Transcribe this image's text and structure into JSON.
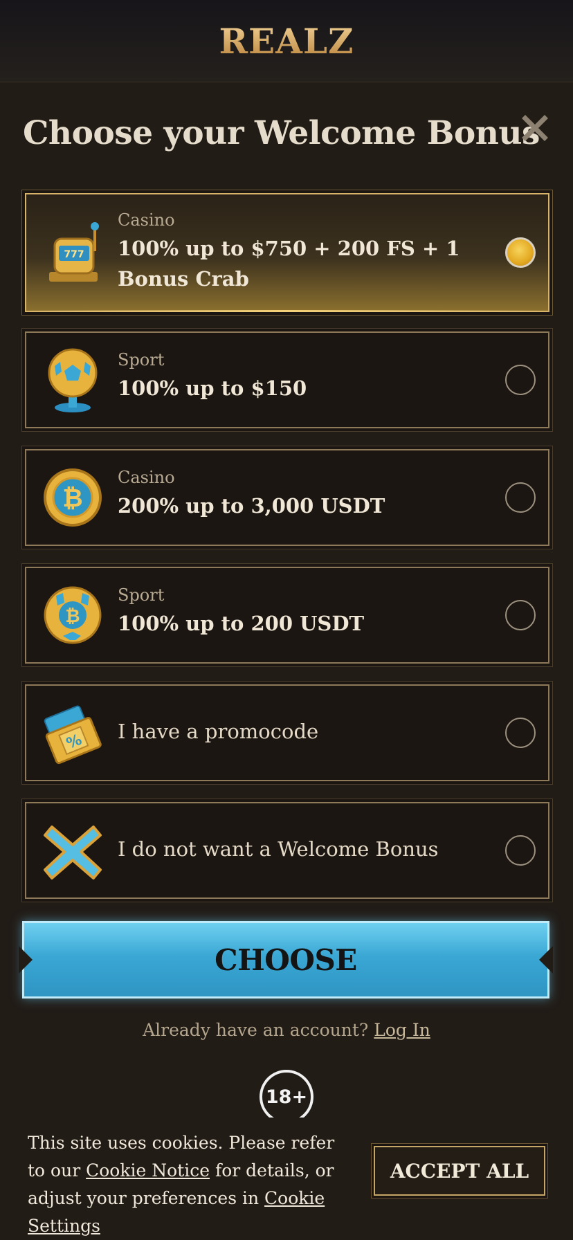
{
  "header": {
    "logo_text": "REALZ"
  },
  "modal": {
    "title": "Choose your Welcome Bonus",
    "close_icon": "close-icon",
    "options": [
      {
        "category": "Casino",
        "label": "100% up to $750 + 200 FS + 1 Bonus Crab",
        "icon": "slot-machine-icon",
        "selected": true
      },
      {
        "category": "Sport",
        "label": "100% up to $150",
        "icon": "soccer-ball-trophy-icon",
        "selected": false
      },
      {
        "category": "Casino",
        "label": "200% up to 3,000 USDT",
        "icon": "bitcoin-coin-icon",
        "selected": false
      },
      {
        "category": "Sport",
        "label": "100% up to 200 USDT",
        "icon": "bitcoin-soccer-ball-icon",
        "selected": false
      },
      {
        "label": "I have a promocode",
        "icon": "promo-ticket-icon",
        "selected": false
      },
      {
        "label": "I do not want a Welcome Bonus",
        "icon": "x-mark-icon",
        "selected": false
      }
    ],
    "choose_label": "CHOOSE",
    "login_prompt": "Already have an account?",
    "login_link": "Log In",
    "age_badge": "18+"
  },
  "cookies": {
    "text_1": "This site uses cookies. Please refer to our",
    "notice_link": "Cookie Notice",
    "text_2": "for details, or adjust your preferences in",
    "settings_link": "Cookie Settings",
    "accept_label": "ACCEPT ALL"
  },
  "colors": {
    "accent_gold": "#d8b46a",
    "accent_blue": "#3aa7d4",
    "background": "#221c17"
  }
}
